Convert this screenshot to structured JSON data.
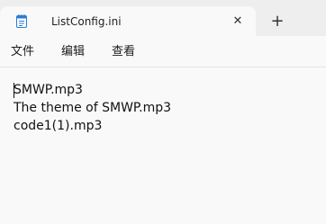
{
  "window": {
    "tab_title": "ListConfig.ini",
    "tab_close_glyph": "✕",
    "new_tab_glyph": "+",
    "tab_icon": "notepad-icon"
  },
  "menu": {
    "items": [
      "文件",
      "编辑",
      "查看"
    ]
  },
  "editor": {
    "lines": [
      "SMWP.mp3",
      "The theme of SMWP.mp3",
      "code1(1).mp3"
    ]
  },
  "colors": {
    "titlebar": "#eeeeee",
    "background": "#f9f9f9",
    "icon_accent": "#2b7bd6"
  }
}
